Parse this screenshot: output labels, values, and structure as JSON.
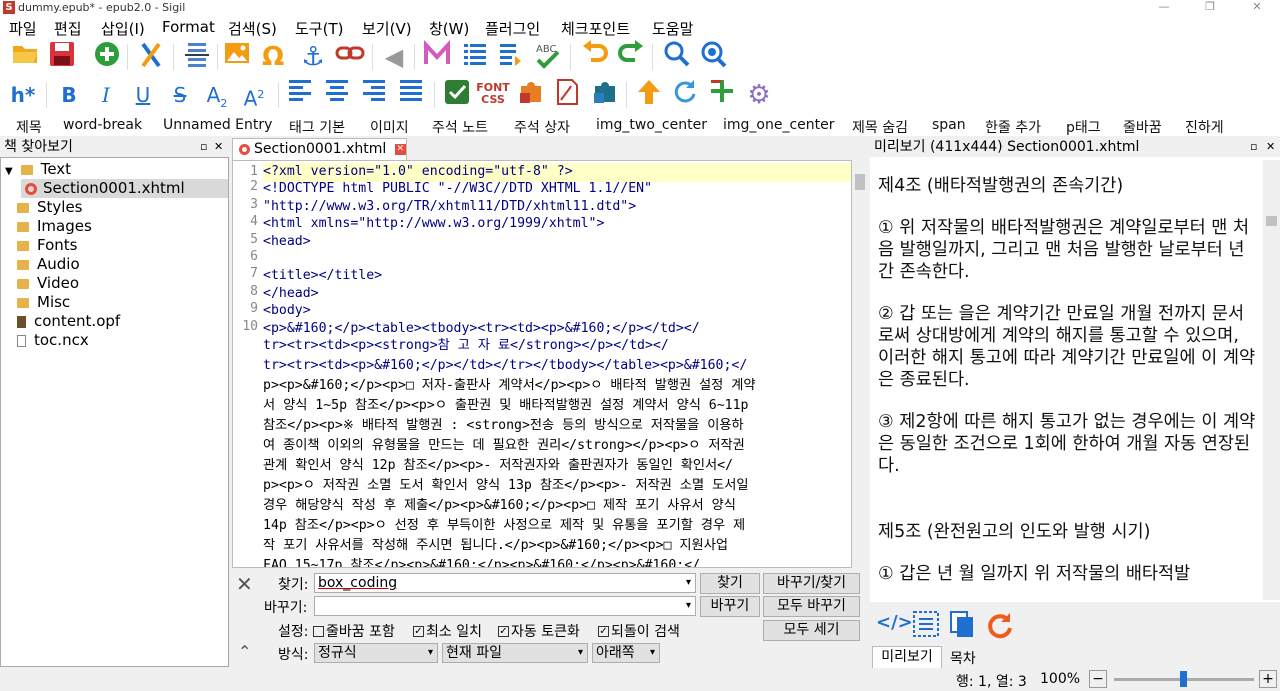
{
  "window": {
    "title": "dummy.epub* - epub2.0 - Sigil",
    "app_icon": "S",
    "min": "—",
    "max": "❐",
    "close": "✕"
  },
  "menu": [
    "파일",
    "편집",
    "삽입(I)",
    "Format",
    "검색(S)",
    "도구(T)",
    "보기(V)",
    "창(W)",
    "플러그인",
    "체크포인트",
    "도움말"
  ],
  "toolbar2": {
    "heading": "h*",
    "bold": "B",
    "italic": "I",
    "underline": "U",
    "strike": "S",
    "sub": "A",
    "sub2": "2",
    "sup": "A",
    "sup2": "2",
    "fontcss": "FONT CSS"
  },
  "clips": [
    "제목",
    "word-break",
    "Unnamed Entry",
    "태그 기본",
    "이미지",
    "주석 노트",
    "주석 상자",
    "img_two_center",
    "img_one_center",
    "제목 숨김",
    "span",
    "한줄 추가",
    "p태그",
    "줄바꿈",
    "진하게"
  ],
  "browser": {
    "title": "책 찾아보기",
    "items": [
      "Text",
      "Section0001.xhtml",
      "Styles",
      "Images",
      "Fonts",
      "Audio",
      "Video",
      "Misc",
      "content.opf",
      "toc.ncx"
    ]
  },
  "editor": {
    "tab": "Section0001.xhtml",
    "line_numbers": [
      "1",
      "2",
      "3",
      "4",
      "5",
      "6",
      "7",
      "8",
      "9",
      "10"
    ],
    "lines": [
      "<?xml version=\"1.0\" encoding=\"utf-8\" ?>",
      "<!DOCTYPE html PUBLIC \"-//W3C//DTD XHTML 1.1//EN\"",
      " \"http://www.w3.org/TR/xhtml11/DTD/xhtml11.dtd\">",
      "<html xmlns=\"http://www.w3.org/1999/xhtml\">",
      "<head>",
      "",
      "  <title></title>",
      "</head>",
      "<body>",
      "<p>&#160;</p><table><tbody><tr><td><p>&#160;</p></td></",
      "tr><tr><td><p><strong>참 고 자 료</strong></p></td></",
      "tr><tr><td><p>&#160;</p></td></tr></tbody></table><p>&#160;</",
      "p><p>&#160;</p><p>□ 저자-출판사 계약서</p><p>ㅇ 배타적 발행권 설정 계약",
      "서 양식 1~5p 참조</p><p>ㅇ 출판권 및 배타적발행권 설정 계약서 양식 6~11p",
      "참조</p><p>※ 배타적 발행권 : <strong>전송 등의 방식으로 저작물을 이용하",
      "여 종이책 이외의 유형물을 만드는 데 필요한 권리</strong></p><p>ㅇ 저작권",
      "관계 확인서 양식 12p 참조</p><p>- 저작권자와 출판권자가 동일인 확인서</",
      "p><p>ㅇ 저작권 소멸 도서 확인서 양식 13p 참조</p><p>- 저작권 소멸 도서일",
      "경우 해당양식 작성 후 제출</p><p>&#160;</p><p>□ 제작 포기 사유서 양식",
      "14p 참조</p><p>ㅇ 선정 후 부득이한 사정으로 제작 및 유통을 포기할 경우 제",
      "작 포기 사유서를 작성해 주시면 됩니다.</p><p>&#160;</p><p>□ 지원사업",
      "FAQ 15~17p 참조</p><p>&#160;</p><p>&#160;</p><p>&#160;</"
    ]
  },
  "preview": {
    "title": "미리보기 (411x444) Section0001.xhtml",
    "paras": [
      "제4조 (배타적발행권의 존속기간)",
      "① 위 저작물의 배타적발행권은 계약일로부터 맨 처음 발행일까지, 그리고 맨 처음 발행한 날로부터 년간 존속한다.",
      "② 갑 또는 을은 계약기간 만료일 개월 전까지 문서로써 상대방에게 계약의 해지를 통고할 수 있으며, 이러한 해지 통고에 따라 계약기간 만료일에 이 계약은 종료된다.",
      "③ 제2항에 따른 해지 통고가 없는 경우에는 이 계약은 동일한 조건으로 1회에 한하여 개월 자동 연장된다.",
      "제5조 (완전원고의 인도와 발행 시기)",
      "① 갑은 년 월 일까지 위 저작물의 배타적발"
    ],
    "tabs": [
      "미리보기",
      "목차"
    ]
  },
  "find": {
    "find_label": "찾기:",
    "find_value": "box_coding",
    "replace_label": "바꾸기:",
    "replace_value": "",
    "btn_find": "찾기",
    "btn_replace_find": "바꾸기/찾기",
    "btn_replace": "바꾸기",
    "btn_replace_all": "모두 바꾸기",
    "btn_count": "모두 세기",
    "options_label": "설정:",
    "opt1": "줄바꿈 포함",
    "opt2": "최소 일치",
    "opt3": "자동 토큰화",
    "opt4": "되돌이 검색",
    "mode_label": "방식:",
    "mode": "정규식",
    "scope": "현재 파일",
    "direction": "아래쪽"
  },
  "status": {
    "pos": "행: 1, 열: 3",
    "zoom": "100%"
  }
}
